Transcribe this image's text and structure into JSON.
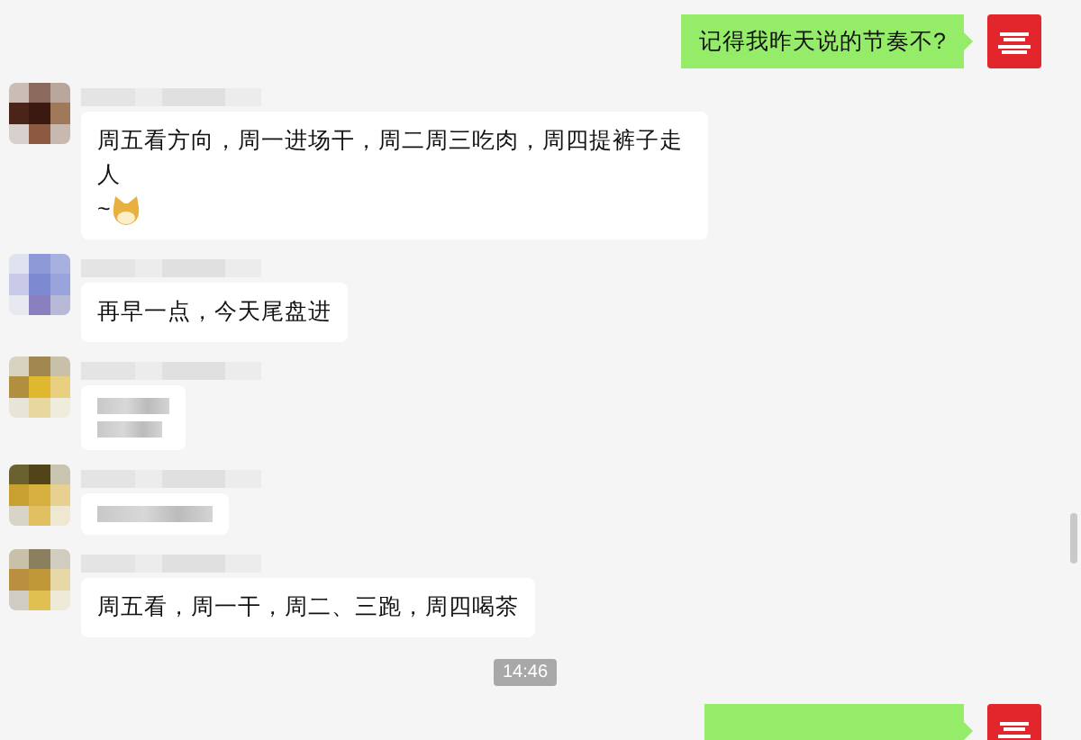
{
  "messages": [
    {
      "kind": "outgoing",
      "text": "记得我昨天说的节奏不?"
    },
    {
      "kind": "incoming",
      "text": "周五看方向，周一进场干，周二周三吃肉，周四提裤子走人",
      "tail": "~",
      "emoji": true
    },
    {
      "kind": "incoming",
      "text": "再早一点，今天尾盘进"
    },
    {
      "kind": "blurred-tall"
    },
    {
      "kind": "blurred"
    },
    {
      "kind": "incoming",
      "text": "周五看，周一干，周二、三跑，周四喝茶"
    },
    {
      "kind": "time",
      "text": "14:46"
    },
    {
      "kind": "outgoing-blurred"
    }
  ]
}
